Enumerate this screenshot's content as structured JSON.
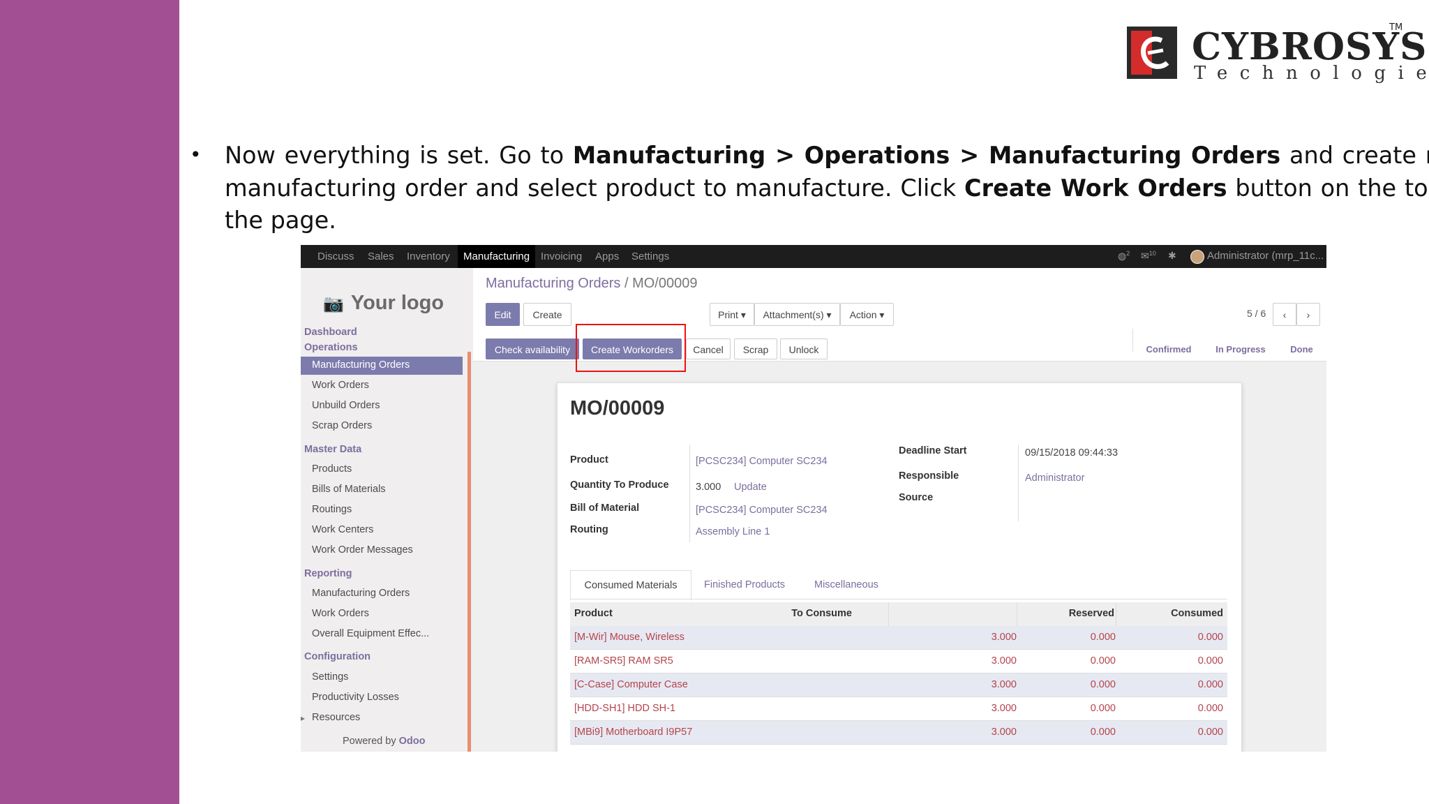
{
  "brand": {
    "name": "CYBROSYS",
    "tm": "TM",
    "sub": "Technologies"
  },
  "instruction": {
    "bullet": "•",
    "p1": "Now everything is set. Go to ",
    "b1": "Manufacturing",
    "sep1": " > ",
    "b2": "Operations",
    "sep2": " > ",
    "b3": "Manufacturing Orders",
    "p2": " and create new manufacturing order and select product to manufacture. Click ",
    "b4": "Create Work Orders",
    "p3": " button on the top of the page."
  },
  "topnav": {
    "menus": [
      "Discuss",
      "Sales",
      "Inventory",
      "Manufacturing",
      "Invoicing",
      "Apps",
      "Settings"
    ],
    "active": "Manufacturing",
    "chat_badge": "2",
    "msg_badge": "10",
    "user": "Administrator (mrp_11c..."
  },
  "sidebar": {
    "logo": "Your logo",
    "sections": {
      "dashboard": "Dashboard",
      "operations": "Operations",
      "master_data": "Master Data",
      "reporting": "Reporting",
      "configuration": "Configuration"
    },
    "operations_items": [
      "Manufacturing Orders",
      "Work Orders",
      "Unbuild Orders",
      "Scrap Orders"
    ],
    "master_items": [
      "Products",
      "Bills of Materials",
      "Routings",
      "Work Centers",
      "Work Order Messages"
    ],
    "reporting_items": [
      "Manufacturing Orders",
      "Work Orders",
      "Overall Equipment Effec..."
    ],
    "config_items": [
      "Settings",
      "Productivity Losses",
      "Resources"
    ],
    "powered_prefix": "Powered by ",
    "powered_brand": "Odoo"
  },
  "control_panel": {
    "breadcrumb_parent": "Manufacturing Orders",
    "breadcrumb_sep": " / ",
    "breadcrumb_current": "MO/00009",
    "edit": "Edit",
    "create": "Create",
    "print": "Print ▾",
    "attachments": "Attachment(s) ▾",
    "action": "Action ▾",
    "pager": "5 / 6",
    "check_availability": "Check availability",
    "create_workorders": "Create Workorders",
    "cancel": "Cancel",
    "scrap": "Scrap",
    "unlock": "Unlock",
    "status": [
      "Confirmed",
      "In Progress",
      "Done"
    ]
  },
  "form": {
    "title": "MO/00009",
    "product_label": "Product",
    "product_value": "[PCSC234] Computer SC234",
    "qty_label": "Quantity To Produce",
    "qty_value": "3.000",
    "qty_update": "Update",
    "bom_label": "Bill of Material",
    "bom_value": "[PCSC234] Computer SC234",
    "routing_label": "Routing",
    "routing_value": "Assembly Line 1",
    "deadline_label": "Deadline Start",
    "deadline_value": "09/15/2018 09:44:33",
    "responsible_label": "Responsible",
    "responsible_value": "Administrator",
    "source_label": "Source",
    "tabs": [
      "Consumed Materials",
      "Finished Products",
      "Miscellaneous"
    ],
    "columns": [
      "Product",
      "To Consume",
      "Reserved",
      "Consumed"
    ],
    "rows": [
      {
        "product": "[M-Wir] Mouse, Wireless",
        "to_consume": "3.000",
        "reserved": "0.000",
        "consumed": "0.000"
      },
      {
        "product": "[RAM-SR5] RAM SR5",
        "to_consume": "3.000",
        "reserved": "0.000",
        "consumed": "0.000"
      },
      {
        "product": "[C-Case] Computer Case",
        "to_consume": "3.000",
        "reserved": "0.000",
        "consumed": "0.000"
      },
      {
        "product": "[HDD-SH1] HDD SH-1",
        "to_consume": "3.000",
        "reserved": "0.000",
        "consumed": "0.000"
      },
      {
        "product": "[MBi9] Motherboard I9P57",
        "to_consume": "3.000",
        "reserved": "0.000",
        "consumed": "0.000"
      }
    ]
  },
  "colors": {
    "slide_bar": "#a24f93",
    "odoo_primary": "#7c7bad",
    "highlight": "#e11111",
    "link": "#7c6e9e",
    "row_text": "#b5434b"
  }
}
